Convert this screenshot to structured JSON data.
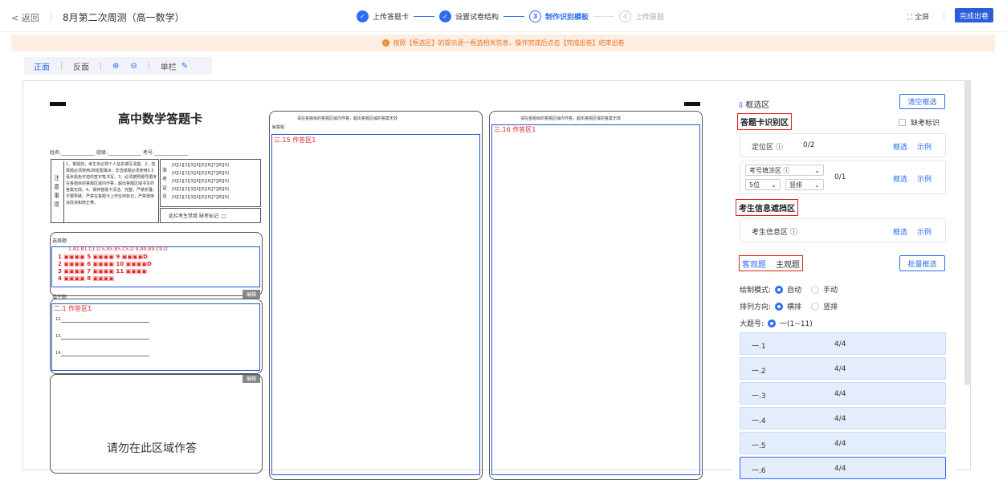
{
  "header": {
    "back": "< 返回",
    "title": "8月第二次周测（高一数学）",
    "steps": [
      {
        "num": "✓",
        "label": "上传答题卡",
        "state": "done"
      },
      {
        "num": "✓",
        "label": "设置试卷结构",
        "state": "done"
      },
      {
        "num": "3",
        "label": "制作识别模板",
        "state": "current"
      },
      {
        "num": "4",
        "label": "上传原题",
        "state": "todo"
      }
    ],
    "fullscreen": "全屏",
    "finish": "完成出卷"
  },
  "notice": "按照【框选区】的提示逐一框选相关信息，操作完成后点击【完成出卷】结束出卷",
  "toolbar": {
    "front": "正面",
    "back": "反面",
    "zoomin": "⊕",
    "zoomout": "⊖",
    "single": "单栏"
  },
  "sheet": {
    "title": "高中数学答题卡",
    "info": "姓名:______________  班级:______________  考号:______________",
    "noteLabel": "注意事项",
    "notes": "1、答题前，考生务必将个人信息填写清楚。2、选择题必须使用2B铅笔填涂；非选择题必须使用0.5毫米黑色字迹的签字笔书写。3、必须按照题号顺序在各题目的答题区域内作答，超出答题区域书写的答案无效。4、保持答题卡清洁、完整，严禁折叠、不要弄破，严禁在答题卡上作任何标记，严禁使用涂改液和修正带。",
    "zkLabel": "准考证号",
    "zkFoot": "此栏考生禁填    缺考标记: □",
    "choiceLabel": "选择题",
    "choiceHead": "1.A1.B1.C1.D    5.A5.B5.C5.D    9.A9.B9.C9.D",
    "choiceRows": [
      "1 ▣▣▣▣  5 ▣▣▣▣  9 ▣▣▣▣D",
      "2 ▣▣▣▣  6 ▣▣▣▣  10 ▣▣▣▣D",
      "3 ▣▣▣▣  7 ▣▣▣▣  11 ▣▣▣▣",
      "4 ▣▣▣▣  8 ▣▣▣▣"
    ],
    "fillLabel": "填空题",
    "fillArea": "二.1 作答区1",
    "blanks": [
      "12.",
      "13.",
      "14."
    ],
    "edit": "编辑",
    "forbid": "请勿在此区域作答",
    "col2Head": "请在各题目的答题区域内作答，超出答题区域的答案无效",
    "col2Label": "解答题",
    "col2Area": "三.15 作答区1",
    "col3Head": "请在各题目的答题区域内作答，超出答题区域的答案无效",
    "col3Area": "三.16 作答区1"
  },
  "panel": {
    "title": "框选区",
    "clear": "清空框选",
    "cardArea": "答题卡识别区",
    "absent": "缺考标识",
    "locate": {
      "label": "定位区 ⓘ",
      "value": "0/2"
    },
    "select": "框选",
    "example": "示例",
    "examNo": {
      "label": "考号填涂区 ⓘ",
      "digits": "5位",
      "dir": "竖排",
      "value": "0/1"
    },
    "maskArea": "考生信息遮挡区",
    "studentInfo": "考生信息区 ⓘ",
    "tabObj": "客观题",
    "tabSubj": "主观题",
    "batch": "批量框选",
    "mode": {
      "label": "绘制模式:",
      "opt1": "自动",
      "opt2": "手动"
    },
    "order": {
      "label": "排列方向:",
      "opt1": "横排",
      "opt2": "竖排"
    },
    "bigq": {
      "label": "大题号:",
      "opt": "一(1~11)"
    },
    "questions": [
      {
        "n": "一.1",
        "v": "4/4"
      },
      {
        "n": "一.2",
        "v": "4/4"
      },
      {
        "n": "一.3",
        "v": "4/4"
      },
      {
        "n": "一.4",
        "v": "4/4"
      },
      {
        "n": "一.5",
        "v": "4/4"
      },
      {
        "n": "一.6",
        "v": "4/4"
      }
    ]
  }
}
